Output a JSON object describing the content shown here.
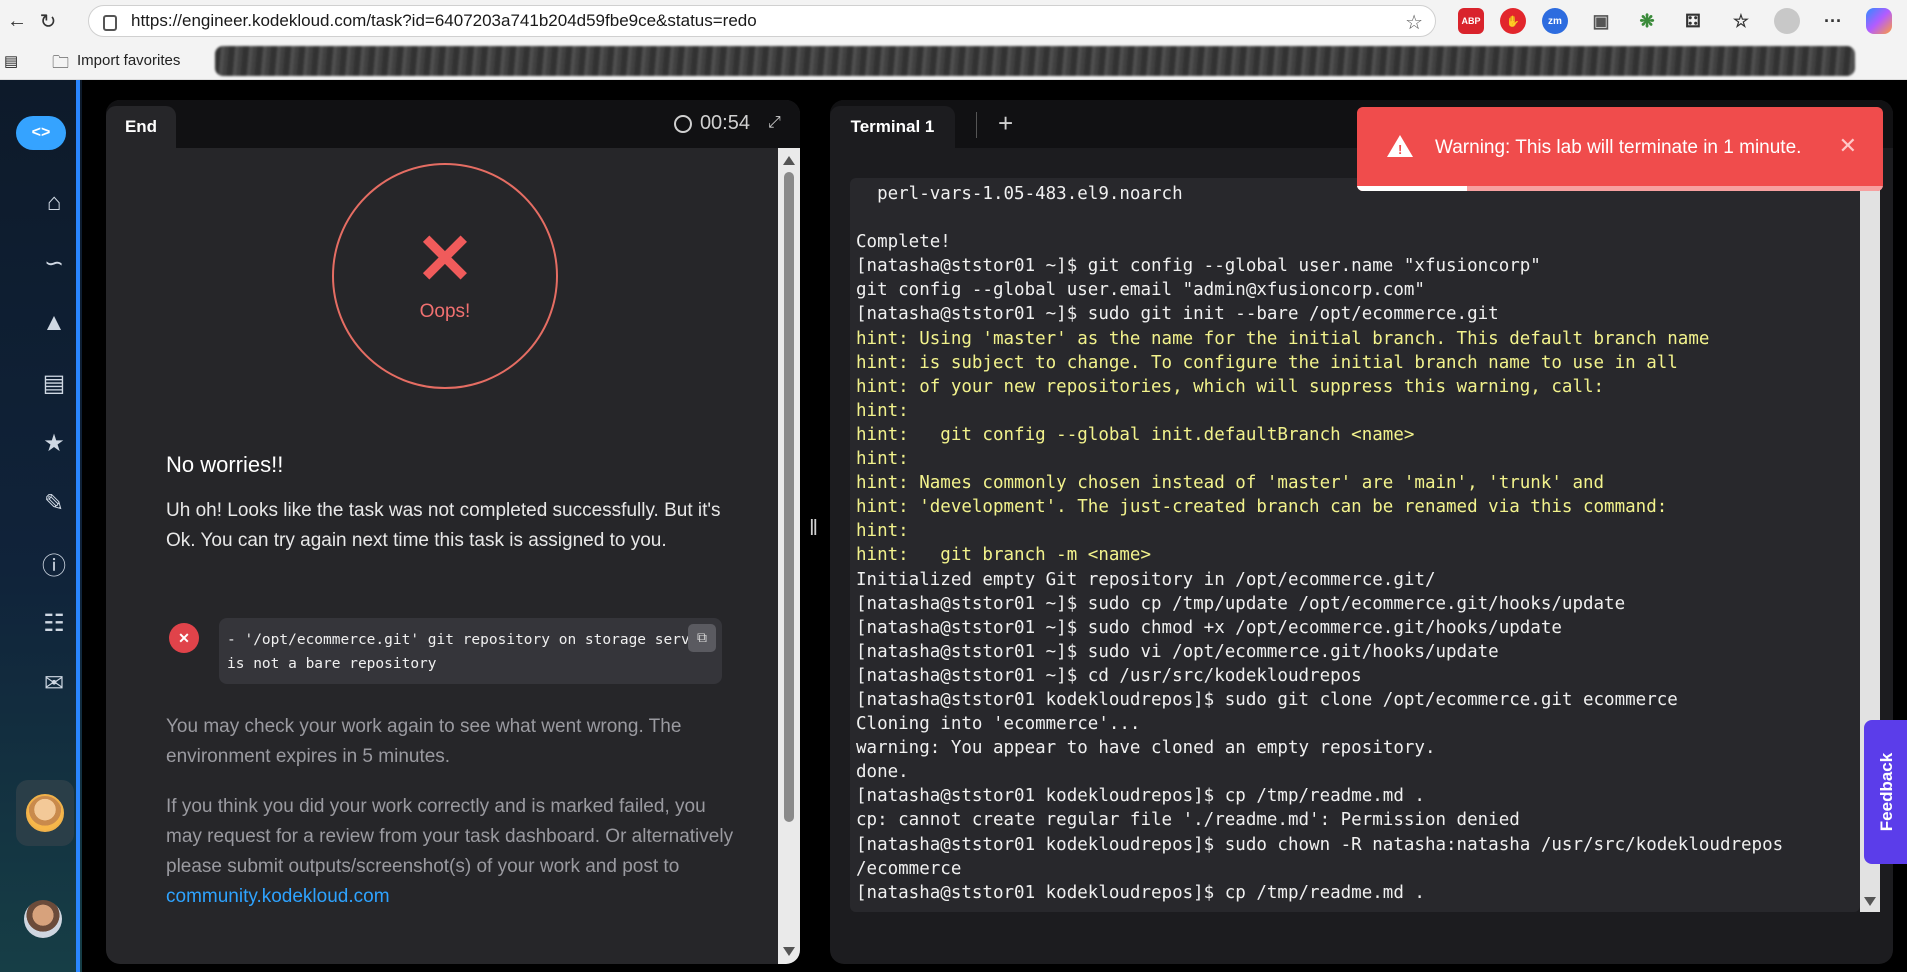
{
  "browser": {
    "url": "https://engineer.kodekloud.com/task?id=6407203a741b204d59fbe9ce&status=redo",
    "bookmarks_label": "Import favorites",
    "extensions": [
      "ABP",
      "zm"
    ]
  },
  "left_panel": {
    "tab_label": "End",
    "timer": "00:54",
    "oops_label": "Oops!",
    "heading": "No worries!!",
    "message": "Uh oh! Looks like the task was not completed successfully. But it's Ok. You can try again next time this task is assigned to you.",
    "error_text": " - '/opt/ecommerce.git' git repository on storage server is not a bare repository",
    "check_message": "You may check your work again to see what went wrong. The environment expires in 5 minutes.",
    "review_message": "If you think you did your work correctly and is marked failed, you may request for a review from your task dashboard. Or alternatively please submit outputs/screenshot(s) of your work and post to ",
    "community_link": "community.kodekloud.com"
  },
  "right_panel": {
    "tab_label": "Terminal 1",
    "terminal_lines": [
      {
        "text": "  perl-vars-1.05-483.el9.noarch",
        "type": "normal"
      },
      {
        "text": "",
        "type": "normal"
      },
      {
        "text": "Complete!",
        "type": "normal"
      },
      {
        "text": "[natasha@ststor01 ~]$ git config --global user.name \"xfusioncorp\"",
        "type": "normal"
      },
      {
        "text": "git config --global user.email \"admin@xfusioncorp.com\"",
        "type": "normal"
      },
      {
        "text": "[natasha@ststor01 ~]$ sudo git init --bare /opt/ecommerce.git",
        "type": "normal"
      },
      {
        "text": "hint: Using 'master' as the name for the initial branch. This default branch name",
        "type": "hint"
      },
      {
        "text": "hint: is subject to change. To configure the initial branch name to use in all",
        "type": "hint"
      },
      {
        "text": "hint: of your new repositories, which will suppress this warning, call:",
        "type": "hint"
      },
      {
        "text": "hint:",
        "type": "hint"
      },
      {
        "text": "hint:   git config --global init.defaultBranch <name>",
        "type": "hint"
      },
      {
        "text": "hint:",
        "type": "hint"
      },
      {
        "text": "hint: Names commonly chosen instead of 'master' are 'main', 'trunk' and",
        "type": "hint"
      },
      {
        "text": "hint: 'development'. The just-created branch can be renamed via this command:",
        "type": "hint"
      },
      {
        "text": "hint:",
        "type": "hint"
      },
      {
        "text": "hint:   git branch -m <name>",
        "type": "hint"
      },
      {
        "text": "Initialized empty Git repository in /opt/ecommerce.git/",
        "type": "normal"
      },
      {
        "text": "[natasha@ststor01 ~]$ sudo cp /tmp/update /opt/ecommerce.git/hooks/update",
        "type": "normal"
      },
      {
        "text": "[natasha@ststor01 ~]$ sudo chmod +x /opt/ecommerce.git/hooks/update",
        "type": "normal"
      },
      {
        "text": "[natasha@ststor01 ~]$ sudo vi /opt/ecommerce.git/hooks/update",
        "type": "normal"
      },
      {
        "text": "[natasha@ststor01 ~]$ cd /usr/src/kodekloudrepos",
        "type": "normal"
      },
      {
        "text": "[natasha@ststor01 kodekloudrepos]$ sudo git clone /opt/ecommerce.git ecommerce",
        "type": "normal"
      },
      {
        "text": "Cloning into 'ecommerce'...",
        "type": "normal"
      },
      {
        "text": "warning: You appear to have cloned an empty repository.",
        "type": "normal"
      },
      {
        "text": "done.",
        "type": "normal"
      },
      {
        "text": "[natasha@ststor01 kodekloudrepos]$ cp /tmp/readme.md .",
        "type": "normal"
      },
      {
        "text": "cp: cannot create regular file './readme.md': Permission denied",
        "type": "normal"
      },
      {
        "text": "[natasha@ststor01 kodekloudrepos]$ sudo chown -R natasha:natasha /usr/src/kodekloudrepos",
        "type": "normal"
      },
      {
        "text": "/ecommerce",
        "type": "normal"
      },
      {
        "text": "[natasha@ststor01 kodekloudrepos]$ cp /tmp/readme.md .",
        "type": "normal"
      }
    ]
  },
  "toast": {
    "message": "Warning: This lab will terminate in 1 minute.",
    "progress": 0.21
  },
  "feedback_label": "Feedback",
  "colors": {
    "accent": "#2a86ff",
    "warning": "#f04c4c",
    "hint": "#f2f28c",
    "link": "#2ea3ff",
    "feedback": "#5b3dea"
  }
}
